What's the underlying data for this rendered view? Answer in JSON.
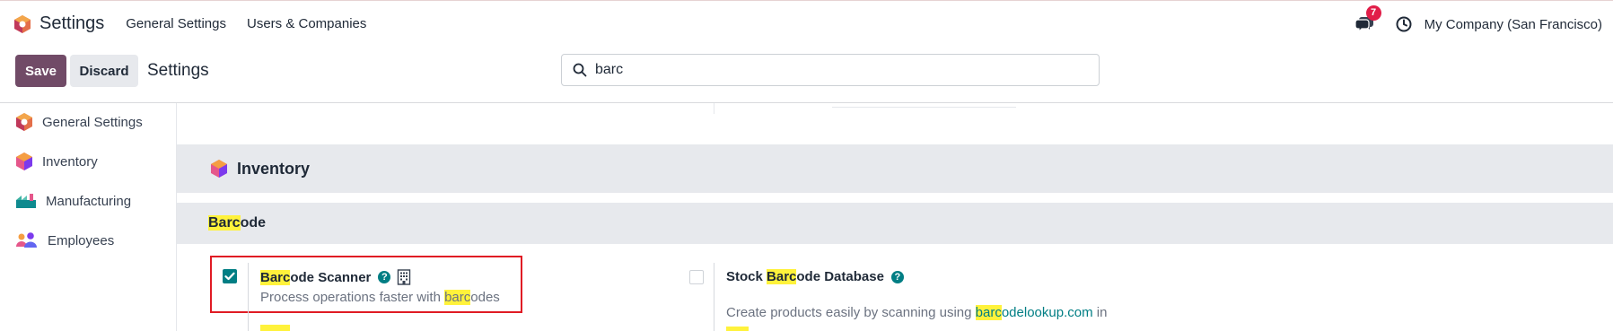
{
  "topbar": {
    "app_title": "Settings",
    "nav": [
      "General Settings",
      "Users & Companies"
    ],
    "notification_count": "7",
    "company": "My Company (San Francisco)"
  },
  "control": {
    "save_label": "Save",
    "discard_label": "Discard",
    "title": "Settings",
    "search_value": "barc"
  },
  "sidebar": {
    "items": [
      {
        "label": "General Settings",
        "icon": "odoo-settings-icon"
      },
      {
        "label": "Inventory",
        "icon": "inventory-icon"
      },
      {
        "label": "Manufacturing",
        "icon": "manufacturing-icon"
      },
      {
        "label": "Employees",
        "icon": "employees-icon"
      }
    ]
  },
  "main": {
    "section_title": "Inventory",
    "subsection": {
      "highlight": "Barc",
      "rest": "ode"
    },
    "settings": [
      {
        "checked": true,
        "title_highlight": "Barc",
        "title_rest": "ode Scanner",
        "desc_prefix": "Process operations faster with ",
        "desc_highlight": "barc",
        "desc_suffix": "odes"
      },
      {
        "checked": false,
        "title_prefix": "Stock ",
        "title_highlight": "Barc",
        "title_rest": "ode Database",
        "desc_prefix": "Create products easily by scanning using ",
        "desc_link_highlight": "barc",
        "desc_link_rest": "odelookup.com",
        "desc_suffix": " in"
      }
    ]
  },
  "colors": {
    "primary": "#714b67",
    "accent": "#017e84",
    "highlight": "#fff23b",
    "badge": "#e11d48",
    "focus_outline": "#e01b24"
  }
}
